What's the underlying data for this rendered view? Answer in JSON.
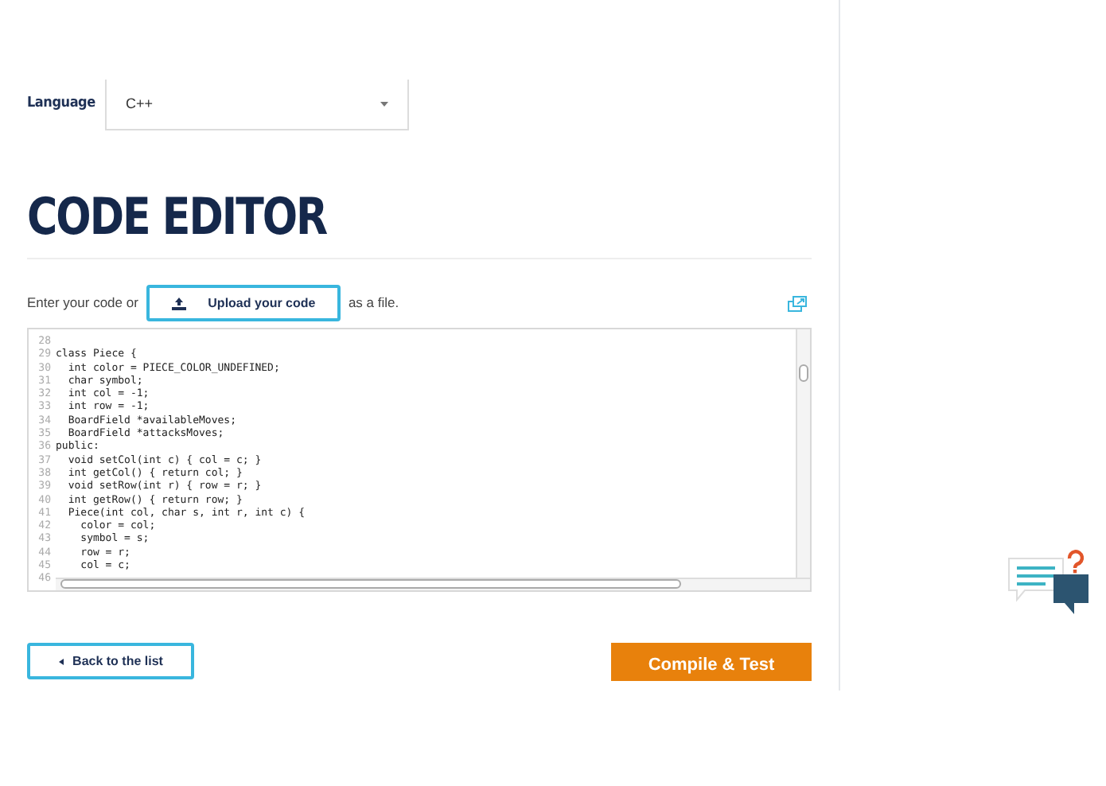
{
  "language": {
    "label": "Language",
    "value": "C++"
  },
  "title": "CODE EDITOR",
  "upload": {
    "before": "Enter your code or",
    "button": "Upload your code",
    "after": "as a file."
  },
  "editor": {
    "lines": [
      {
        "number": "28"
      },
      {
        "number": "29",
        "text": "class Piece {"
      },
      {
        "number": "30",
        "text": "  int color = PIECE_COLOR_UNDEFINED;"
      },
      {
        "number": "31",
        "text": "  char symbol;"
      },
      {
        "number": "32",
        "text": "  int col = -1;"
      },
      {
        "number": "33",
        "text": "  int row = -1;"
      },
      {
        "number": "34",
        "text": "  BoardField *availableMoves;"
      },
      {
        "number": "35",
        "text": "  BoardField *attacksMoves;"
      },
      {
        "number": "36",
        "text": "public:"
      },
      {
        "number": "37",
        "text": "  void setCol(int c) { col = c; }"
      },
      {
        "number": "38",
        "text": "  int getCol() { return col; }"
      },
      {
        "number": "39",
        "text": "  void setRow(int r) { row = r; }"
      },
      {
        "number": "40",
        "text": "  int getRow() { return row; }"
      },
      {
        "number": "41",
        "text": "  Piece(int col, char s, int r, int c) {"
      },
      {
        "number": "42",
        "text": "    color = col;"
      },
      {
        "number": "43",
        "text": "    symbol = s;"
      },
      {
        "number": "44",
        "text": "    row = r;"
      },
      {
        "number": "45",
        "text": "    col = c;"
      },
      {
        "number": "46"
      }
    ]
  },
  "buttons": {
    "back": "Back to the list",
    "compile": "Compile & Test"
  }
}
